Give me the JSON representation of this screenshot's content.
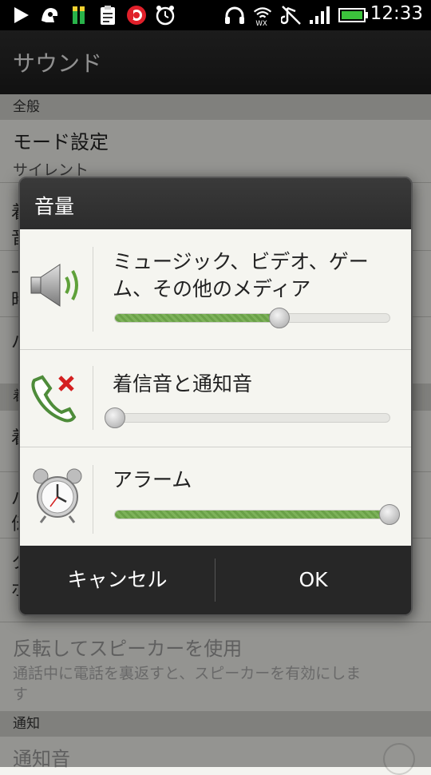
{
  "status_bar": {
    "time": "12:33",
    "icons": [
      "play-icon",
      "app-icon",
      "signal-meter-icon",
      "clipboard-icon",
      "beats-icon",
      "alarm-clock-icon",
      "headphones-icon",
      "wifi-icon",
      "mute-icon",
      "cell-signal-icon",
      "battery-icon"
    ]
  },
  "app": {
    "title": "サウンド"
  },
  "background": {
    "section_general": "全般",
    "mode_title": "モード設定",
    "mode_sub": "サイレント",
    "section_notify": "通知",
    "flip_title": "反転してスピーカーを使用",
    "flip_sub": "通話中に電話を裏返すと、スピーカーを有効にします",
    "notify_sound": "通知音",
    "fragments": [
      "着",
      "音",
      "一",
      "時",
      "バ",
      "着",
      "着",
      "バ",
      "伝",
      "ク",
      "ポ",
      "着"
    ]
  },
  "dialog": {
    "title": "音量",
    "items": [
      {
        "label": "ミュージック、ビデオ、ゲーム、その他のメディア",
        "icon": "speaker-icon",
        "level": 0.6
      },
      {
        "label": "着信音と通知音",
        "icon": "ringer-off-icon",
        "level": 0.0
      },
      {
        "label": "アラーム",
        "icon": "alarm-clock-icon",
        "level": 1.0
      }
    ],
    "cancel": "キャンセル",
    "ok": "OK"
  },
  "colors": {
    "accent_green": "#6aa148",
    "dialog_dark": "#2b2b2b"
  }
}
